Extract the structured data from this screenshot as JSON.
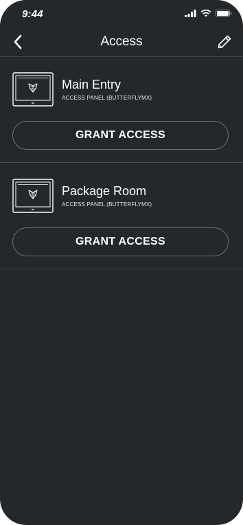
{
  "status_bar": {
    "time": "9:44",
    "icons": [
      "signal-icon",
      "wifi-icon",
      "battery-icon"
    ]
  },
  "nav": {
    "title": "Access",
    "left_icon": "back-chevron-icon",
    "right_icon": "pencil-icon"
  },
  "panels": [
    {
      "name": "Main Entry",
      "type": "ACCESS PANEL (BUTTERFLYMX)",
      "button_label": "GRANT ACCESS",
      "icon": "access-panel-icon"
    },
    {
      "name": "Package Room",
      "type": "ACCESS PANEL (BUTTERFLYMX)",
      "button_label": "GRANT ACCESS",
      "icon": "access-panel-icon"
    }
  ],
  "colors": {
    "background": "#25282b",
    "divider": "#45494d",
    "button_border": "#6d7176",
    "text": "#ffffff"
  }
}
